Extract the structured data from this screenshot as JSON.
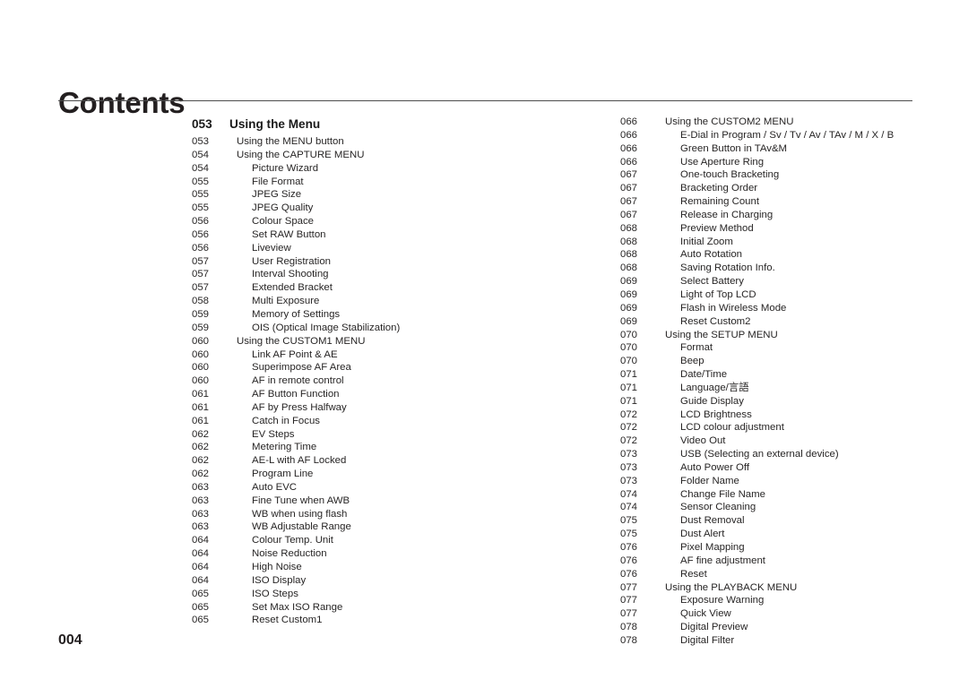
{
  "header": {
    "title": "Contents"
  },
  "footer": {
    "page_number": "004"
  },
  "colors": {
    "text": "#272525",
    "heading": "#1a1a1a",
    "rule": "#4d4d4d",
    "background": "#ffffff"
  },
  "toc": {
    "left_column": [
      {
        "page": "053",
        "label": "Using the Menu",
        "level": "heading"
      },
      {
        "page": "053",
        "label": "Using the MENU button",
        "level": "lvl1"
      },
      {
        "page": "054",
        "label": "Using the CAPTURE MENU",
        "level": "lvl1"
      },
      {
        "page": "054",
        "label": "Picture Wizard",
        "level": "lvl2"
      },
      {
        "page": "055",
        "label": "File Format",
        "level": "lvl2"
      },
      {
        "page": "055",
        "label": "JPEG Size",
        "level": "lvl2"
      },
      {
        "page": "055",
        "label": "JPEG Quality",
        "level": "lvl2"
      },
      {
        "page": "056",
        "label": "Colour Space",
        "level": "lvl2"
      },
      {
        "page": "056",
        "label": "Set RAW Button",
        "level": "lvl2"
      },
      {
        "page": "056",
        "label": "Liveview",
        "level": "lvl2"
      },
      {
        "page": "057",
        "label": "User Registration",
        "level": "lvl2"
      },
      {
        "page": "057",
        "label": "Interval Shooting",
        "level": "lvl2"
      },
      {
        "page": "057",
        "label": "Extended Bracket",
        "level": "lvl2"
      },
      {
        "page": "058",
        "label": "Multi Exposure",
        "level": "lvl2"
      },
      {
        "page": "059",
        "label": "Memory of Settings",
        "level": "lvl2"
      },
      {
        "page": "059",
        "label": "OIS (Optical Image Stabilization)",
        "level": "lvl2"
      },
      {
        "page": "060",
        "label": "Using the CUSTOM1 MENU",
        "level": "lvl1"
      },
      {
        "page": "060",
        "label": "Link AF Point & AE",
        "level": "lvl2"
      },
      {
        "page": "060",
        "label": "Superimpose AF Area",
        "level": "lvl2"
      },
      {
        "page": "060",
        "label": "AF in remote control",
        "level": "lvl2"
      },
      {
        "page": "061",
        "label": "AF Button Function",
        "level": "lvl2"
      },
      {
        "page": "061",
        "label": "AF by Press Halfway",
        "level": "lvl2"
      },
      {
        "page": "061",
        "label": "Catch in Focus",
        "level": "lvl2"
      },
      {
        "page": "062",
        "label": "EV Steps",
        "level": "lvl2"
      },
      {
        "page": "062",
        "label": "Metering Time",
        "level": "lvl2"
      },
      {
        "page": "062",
        "label": "AE-L with AF Locked",
        "level": "lvl2"
      },
      {
        "page": "062",
        "label": "Program Line",
        "level": "lvl2"
      },
      {
        "page": "063",
        "label": "Auto EVC",
        "level": "lvl2"
      },
      {
        "page": "063",
        "label": "Fine Tune when AWB",
        "level": "lvl2"
      },
      {
        "page": "063",
        "label": "WB when using flash",
        "level": "lvl2"
      },
      {
        "page": "063",
        "label": "WB Adjustable Range",
        "level": "lvl2"
      },
      {
        "page": "064",
        "label": "Colour Temp. Unit",
        "level": "lvl2"
      },
      {
        "page": "064",
        "label": "Noise Reduction",
        "level": "lvl2"
      },
      {
        "page": "064",
        "label": "High Noise",
        "level": "lvl2"
      },
      {
        "page": "064",
        "label": "ISO Display",
        "level": "lvl2"
      },
      {
        "page": "065",
        "label": "ISO Steps",
        "level": "lvl2"
      },
      {
        "page": "065",
        "label": "Set Max ISO Range",
        "level": "lvl2"
      },
      {
        "page": "065",
        "label": "Reset Custom1",
        "level": "lvl2"
      }
    ],
    "right_column": [
      {
        "page": "066",
        "label": "Using the CUSTOM2 MENU",
        "level": "lvl1"
      },
      {
        "page": "066",
        "label": "E-Dial in Program / Sv / Tv / Av / TAv / M / X / B",
        "level": "lvl2"
      },
      {
        "page": "066",
        "label": "Green Button in TAv&M",
        "level": "lvl2"
      },
      {
        "page": "066",
        "label": "Use Aperture Ring",
        "level": "lvl2"
      },
      {
        "page": "067",
        "label": "One-touch Bracketing",
        "level": "lvl2"
      },
      {
        "page": "067",
        "label": "Bracketing Order",
        "level": "lvl2"
      },
      {
        "page": "067",
        "label": "Remaining Count",
        "level": "lvl2"
      },
      {
        "page": "067",
        "label": "Release in Charging",
        "level": "lvl2"
      },
      {
        "page": "068",
        "label": "Preview Method",
        "level": "lvl2"
      },
      {
        "page": "068",
        "label": "Initial Zoom",
        "level": "lvl2"
      },
      {
        "page": "068",
        "label": "Auto Rotation",
        "level": "lvl2"
      },
      {
        "page": "068",
        "label": "Saving Rotation Info.",
        "level": "lvl2"
      },
      {
        "page": "069",
        "label": "Select Battery",
        "level": "lvl2"
      },
      {
        "page": "069",
        "label": "Light of Top LCD",
        "level": "lvl2"
      },
      {
        "page": "069",
        "label": "Flash in Wireless Mode",
        "level": "lvl2"
      },
      {
        "page": "069",
        "label": "Reset Custom2",
        "level": "lvl2"
      },
      {
        "page": "070",
        "label": "Using the SETUP MENU",
        "level": "lvl1"
      },
      {
        "page": "070",
        "label": "Format",
        "level": "lvl2"
      },
      {
        "page": "070",
        "label": "Beep",
        "level": "lvl2"
      },
      {
        "page": "071",
        "label": "Date/Time",
        "level": "lvl2"
      },
      {
        "page": "071",
        "label": "Language/言語",
        "level": "lvl2"
      },
      {
        "page": "071",
        "label": "Guide Display",
        "level": "lvl2"
      },
      {
        "page": "072",
        "label": "LCD Brightness",
        "level": "lvl2"
      },
      {
        "page": "072",
        "label": "LCD colour adjustment",
        "level": "lvl2"
      },
      {
        "page": "072",
        "label": "Video Out",
        "level": "lvl2"
      },
      {
        "page": "073",
        "label": "USB (Selecting an external device)",
        "level": "lvl2"
      },
      {
        "page": "073",
        "label": "Auto Power Off",
        "level": "lvl2"
      },
      {
        "page": "073",
        "label": "Folder Name",
        "level": "lvl2"
      },
      {
        "page": "074",
        "label": "Change File Name",
        "level": "lvl2"
      },
      {
        "page": "074",
        "label": "Sensor Cleaning",
        "level": "lvl2"
      },
      {
        "page": "075",
        "label": "Dust Removal",
        "level": "lvl2"
      },
      {
        "page": "075",
        "label": "Dust Alert",
        "level": "lvl2"
      },
      {
        "page": "076",
        "label": "Pixel Mapping",
        "level": "lvl2"
      },
      {
        "page": "076",
        "label": "AF fine adjustment",
        "level": "lvl2"
      },
      {
        "page": "076",
        "label": "Reset",
        "level": "lvl2"
      },
      {
        "page": "077",
        "label": "Using the PLAYBACK MENU",
        "level": "lvl1"
      },
      {
        "page": "077",
        "label": "Exposure Warning",
        "level": "lvl2"
      },
      {
        "page": "077",
        "label": "Quick View",
        "level": "lvl2"
      },
      {
        "page": "078",
        "label": "Digital Preview",
        "level": "lvl2"
      },
      {
        "page": "078",
        "label": "Digital Filter",
        "level": "lvl2"
      }
    ]
  }
}
